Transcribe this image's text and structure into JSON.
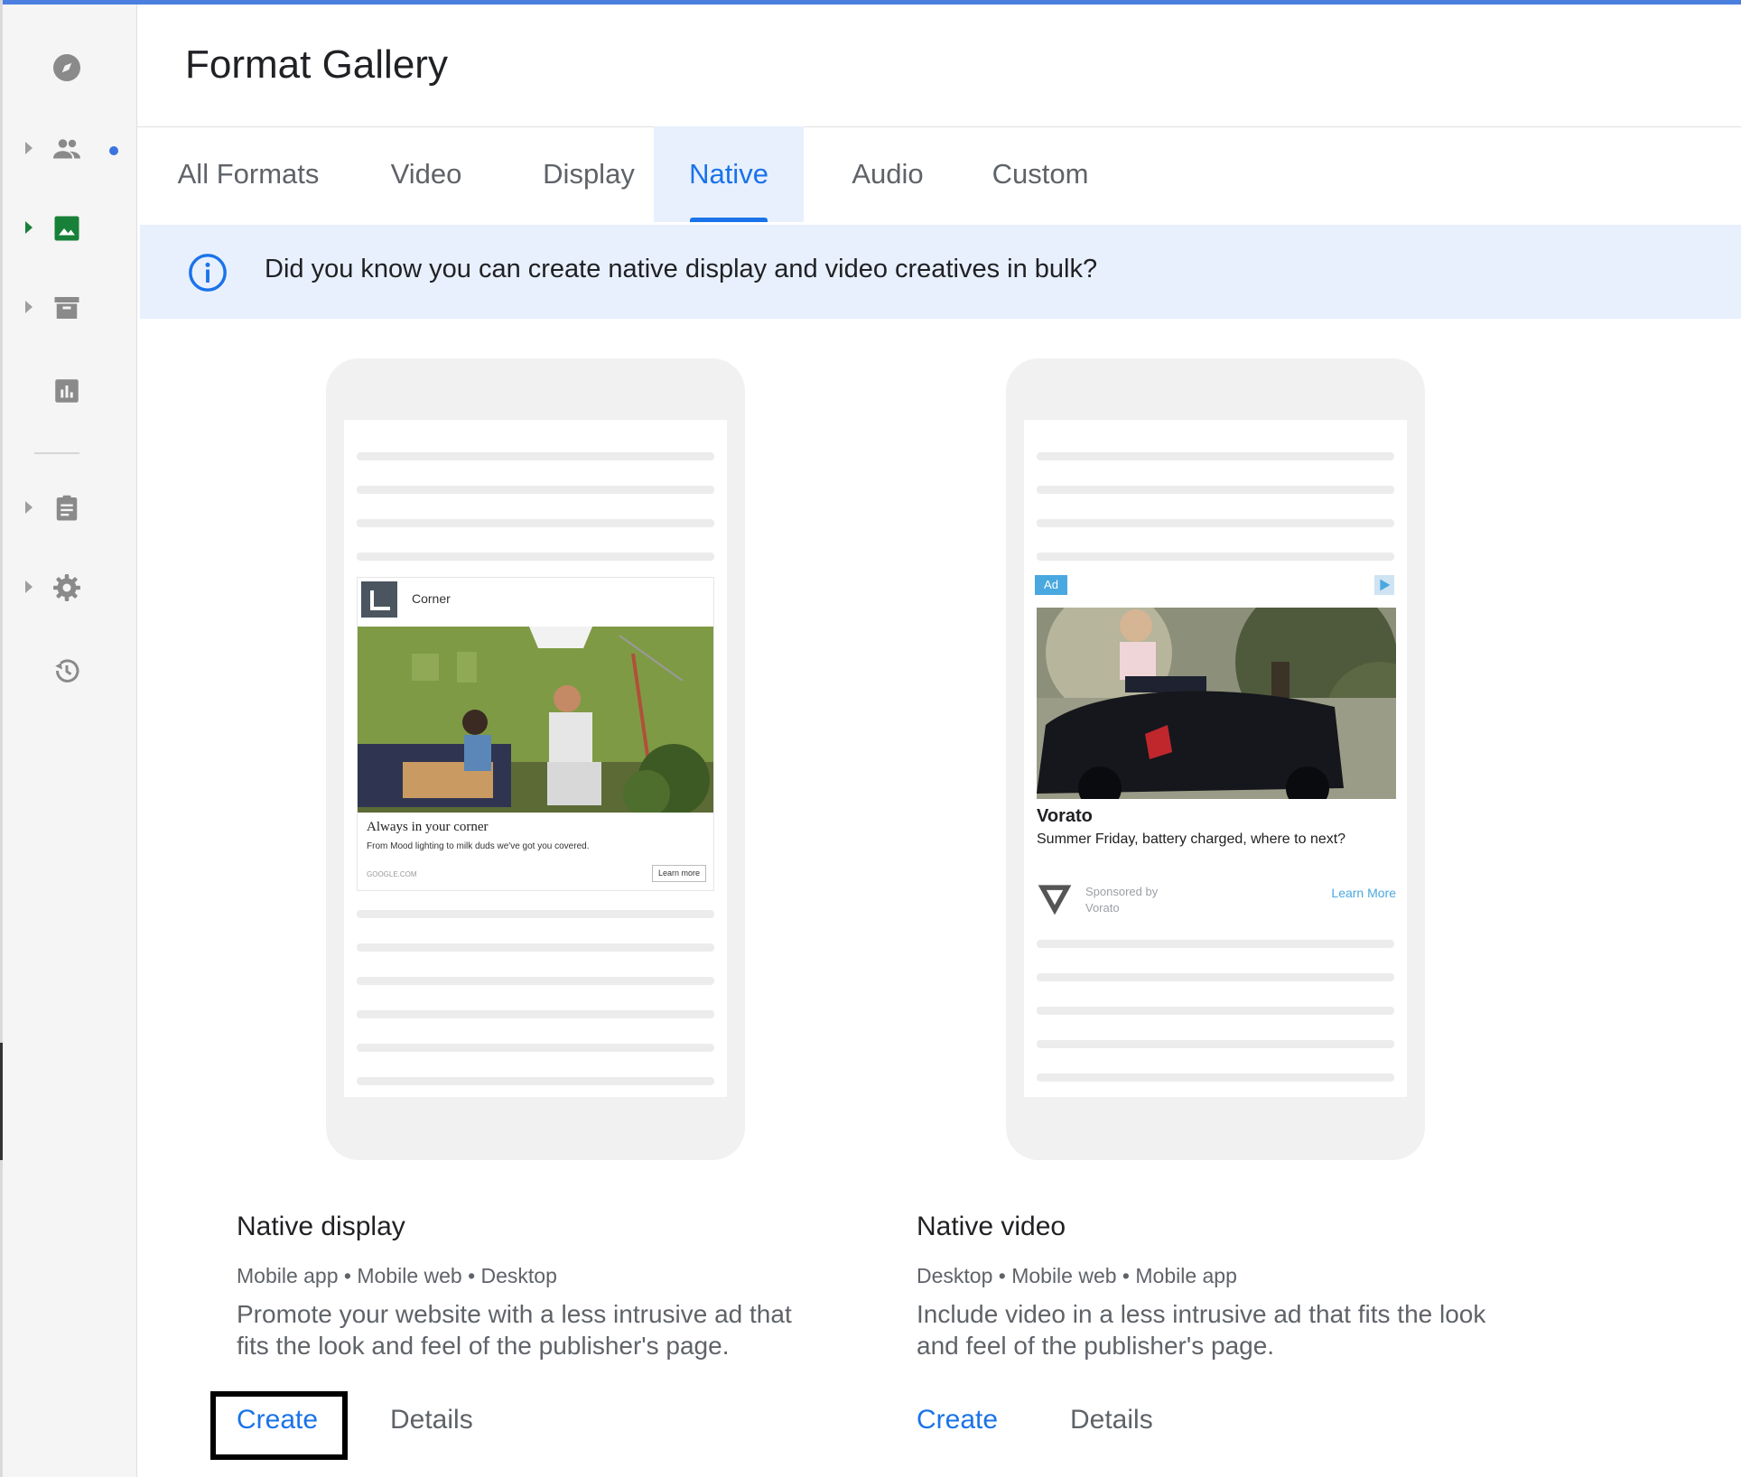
{
  "header": {
    "title": "Format Gallery"
  },
  "sidebar": {
    "items": [
      {
        "icon": "explore-icon",
        "has_caret": false
      },
      {
        "icon": "people-icon",
        "has_caret": true,
        "has_dot": true
      },
      {
        "icon": "image-icon",
        "has_caret": true,
        "active": true
      },
      {
        "icon": "archive-icon",
        "has_caret": true
      },
      {
        "icon": "bar-chart-icon",
        "has_caret": false
      },
      {
        "icon": "clipboard-icon",
        "has_caret": true
      },
      {
        "icon": "gear-icon",
        "has_caret": true
      },
      {
        "icon": "history-icon",
        "has_caret": false
      }
    ]
  },
  "tabs": [
    {
      "label": "All Formats",
      "active": false
    },
    {
      "label": "Video",
      "active": false
    },
    {
      "label": "Display",
      "active": false
    },
    {
      "label": "Native",
      "active": true
    },
    {
      "label": "Audio",
      "active": false
    },
    {
      "label": "Custom",
      "active": false
    }
  ],
  "banner": {
    "text": "Did you know you can create native display and video creatives in bulk?",
    "icon": "info-icon"
  },
  "cards": [
    {
      "title": "Native display",
      "platforms": "Mobile app • Mobile web • Desktop",
      "description_line1": "Promote your website with a less intrusive ad that",
      "description_line2": "fits the look and feel of the publisher's page.",
      "create_label": "Create",
      "details_label": "Details",
      "preview": {
        "brand": "Corner",
        "headline": "Always in your corner",
        "description": "From Mood lighting to milk duds we've got you covered.",
        "domain": "GOOGLE.COM",
        "button": "Learn more"
      }
    },
    {
      "title": "Native video",
      "platforms": "Desktop • Mobile web • Mobile app",
      "description_line1": "Include video in a less intrusive ad that fits the look",
      "description_line2": "and feel of the publisher's page.",
      "create_label": "Create",
      "details_label": "Details",
      "preview": {
        "badge": "Ad",
        "title": "Vorato",
        "description": "Summer Friday, battery charged, where to next?",
        "sponsor_line1": "Sponsored by",
        "sponsor_line2": "Vorato",
        "cta": "Learn More"
      }
    }
  ],
  "colors": {
    "accent": "#1a73e8",
    "banner_bg": "#e8f0fe",
    "sidebar_bg": "#f5f5f5",
    "active_nav": "#188038"
  }
}
